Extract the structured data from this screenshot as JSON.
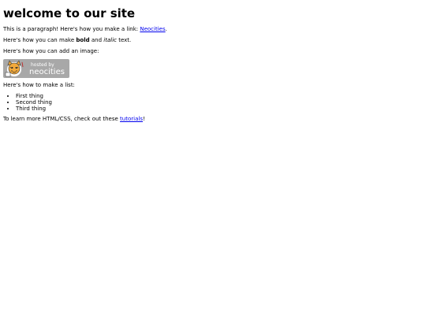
{
  "heading": "welcome to our site",
  "para1": {
    "text": "This is a paragraph! Here's how you make a link: ",
    "link": "Neocities",
    "end": "."
  },
  "para2": {
    "text": "Here's how you can make ",
    "bold": "bold",
    "mid": " and ",
    "italic": "italic",
    "end": " text."
  },
  "para3": "Here's how you can add an image:",
  "badge": {
    "line1": "hosted by",
    "line2": "neocities",
    "bg": "#a8a8a8",
    "accent": "#f2a93b"
  },
  "para4": "Here's how to make a list:",
  "list": [
    "First thing",
    "Second thing",
    "Third thing"
  ],
  "para5": {
    "text": "To learn more HTML/CSS, check out these ",
    "link": "tutorials",
    "end": "!"
  }
}
